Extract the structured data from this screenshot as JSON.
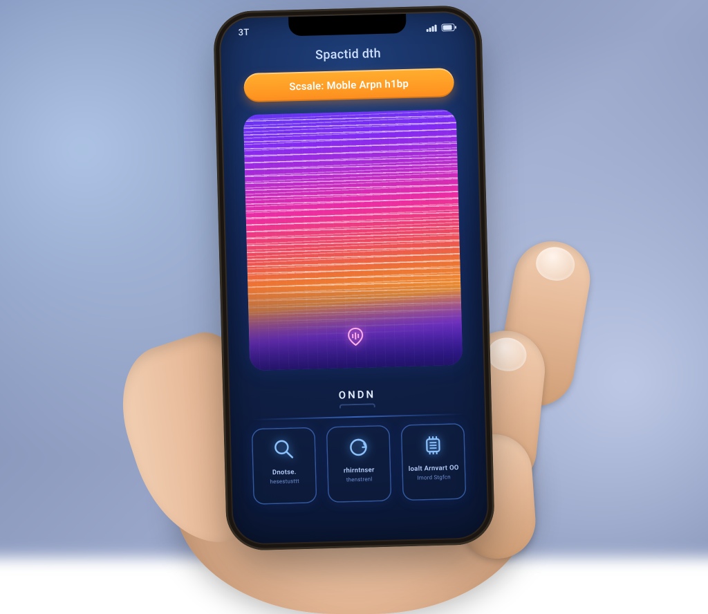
{
  "statusbar": {
    "time": "3T"
  },
  "header": {
    "title": "Spactid dth",
    "pill_label": "Scsale: Moble Arpn h1bp"
  },
  "mid": {
    "label": "ONDN"
  },
  "tiles": [
    {
      "main": "Dnotse.",
      "sub": "hesestusttt"
    },
    {
      "main": "rhirntnser",
      "sub": "thenstrenl"
    },
    {
      "main": "loalt Arnvart OO",
      "sub": "Imord Stgfcn"
    }
  ]
}
